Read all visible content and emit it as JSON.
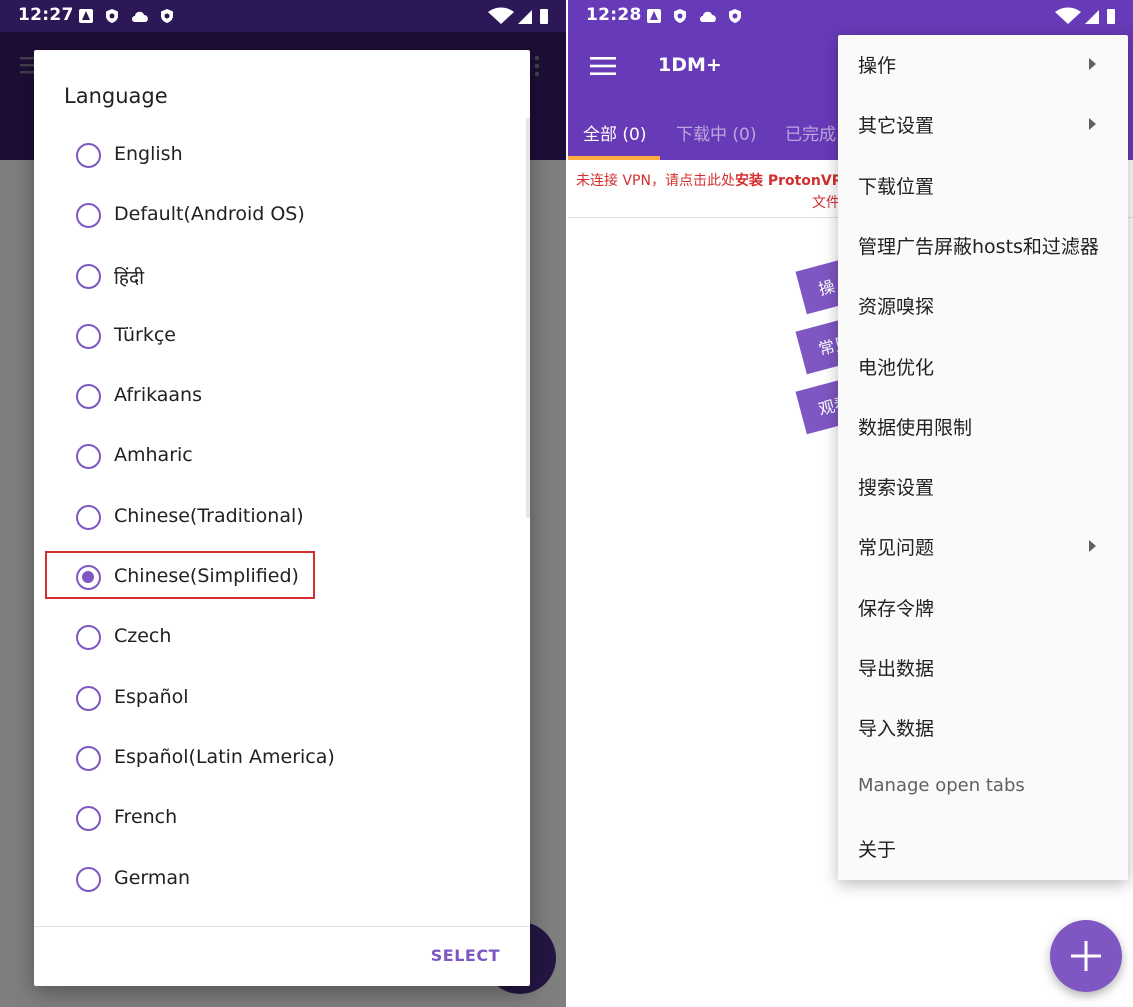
{
  "left": {
    "status_time": "12:27",
    "dialog": {
      "title": "Language",
      "options": [
        {
          "label": "English",
          "checked": false
        },
        {
          "label": "Default(Android OS)",
          "checked": false
        },
        {
          "label": "हिंदी",
          "checked": false
        },
        {
          "label": "Türkçe",
          "checked": false
        },
        {
          "label": "Afrikaans",
          "checked": false
        },
        {
          "label": "Amharic",
          "checked": false
        },
        {
          "label": "Chinese(Traditional)",
          "checked": false
        },
        {
          "label": "Chinese(Simplified)",
          "checked": true
        },
        {
          "label": "Czech",
          "checked": false
        },
        {
          "label": "Español",
          "checked": false
        },
        {
          "label": "Español(Latin America)",
          "checked": false
        },
        {
          "label": "French",
          "checked": false
        },
        {
          "label": "German",
          "checked": false
        }
      ],
      "select_label": "SELECT"
    }
  },
  "right": {
    "status_time": "12:28",
    "app_title": "1DM+",
    "tabs": [
      {
        "label": "全部 (0)",
        "active": true
      },
      {
        "label": "下载中 (0)",
        "active": false
      },
      {
        "label": "已完成",
        "active": false
      }
    ],
    "banner": {
      "line1_prefix": "未连接 VPN，请点击此处",
      "line1_bold": "安装 ProtonVP",
      "line2": "文件"
    },
    "cards": [
      "操",
      "常见",
      "观看"
    ],
    "menu": [
      {
        "label": "操作",
        "submenu": true
      },
      {
        "label": "其它设置",
        "submenu": true
      },
      {
        "label": "下载位置",
        "submenu": false
      },
      {
        "label": "管理广告屏蔽hosts和过滤器",
        "submenu": false
      },
      {
        "label": "资源嗅探",
        "submenu": false
      },
      {
        "label": "电池优化",
        "submenu": false
      },
      {
        "label": "数据使用限制",
        "submenu": false
      },
      {
        "label": "搜索设置",
        "submenu": false
      },
      {
        "label": "常见问题",
        "submenu": true
      },
      {
        "label": "保存令牌",
        "submenu": false
      },
      {
        "label": "导出数据",
        "submenu": false
      },
      {
        "label": "导入数据",
        "submenu": false
      },
      {
        "label": "Manage open tabs",
        "submenu": false,
        "muted": true
      },
      {
        "label": "关于",
        "submenu": false
      }
    ]
  },
  "colors": {
    "accent": "#7e57c2",
    "appbar_purple": "#673ab7",
    "highlight_red": "#d32f2f",
    "tab_indicator": "#ffab40"
  },
  "icons": [
    "menu-icon",
    "more-vert-icon",
    "radio-button-icon",
    "submenu-arrow-icon",
    "add-icon",
    "wifi-icon",
    "signal-icon",
    "battery-icon"
  ]
}
